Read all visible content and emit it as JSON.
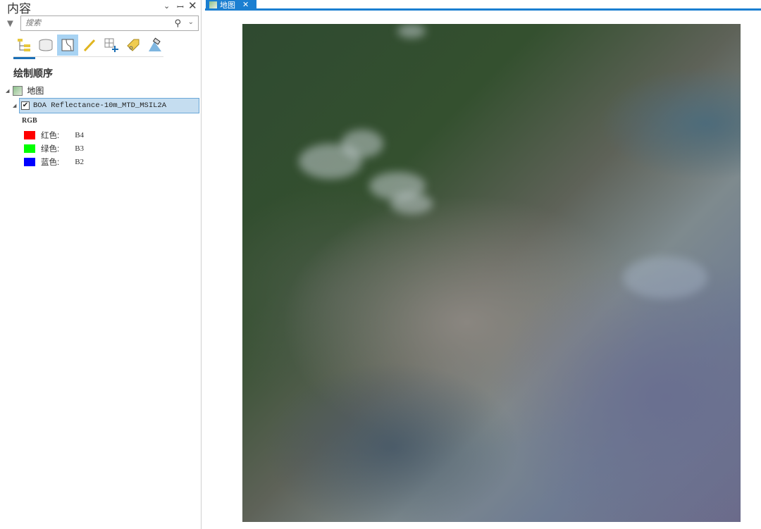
{
  "panel": {
    "title": "内容",
    "search_placeholder": "搜索",
    "section": "绘制顺序",
    "map_name": "地图",
    "layer_name": "BOA Reflectance-10m_MTD_MSIL2A",
    "renderer": "RGB",
    "bands": [
      {
        "label": "红色:",
        "band": "B4",
        "color": "#ff0000"
      },
      {
        "label": "绿色:",
        "band": "B3",
        "color": "#00ff00"
      },
      {
        "label": "蓝色:",
        "band": "B2",
        "color": "#0000ff"
      }
    ]
  },
  "view": {
    "tab_label": "地图"
  }
}
